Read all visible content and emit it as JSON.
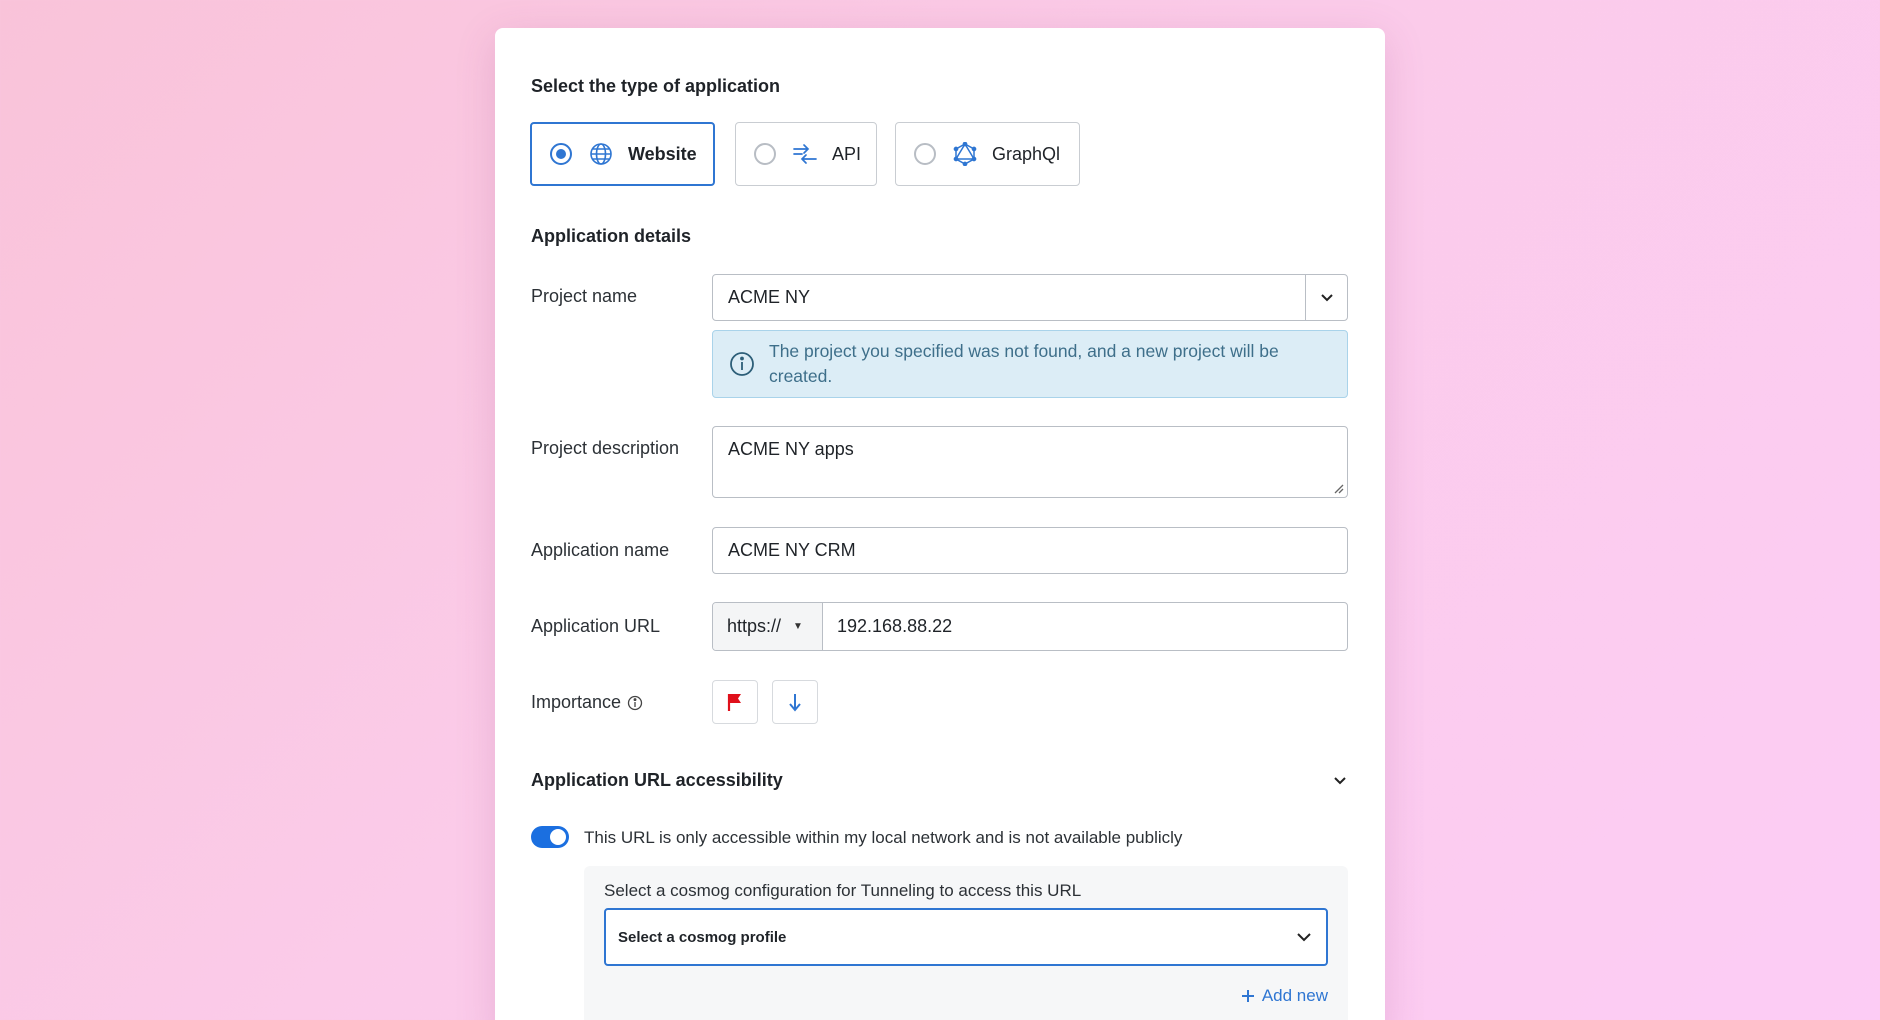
{
  "type_section": {
    "title": "Select the type of application",
    "options": [
      {
        "label": "Website",
        "selected": true,
        "icon": "globe-icon"
      },
      {
        "label": "API",
        "selected": false,
        "icon": "api-arrows-icon"
      },
      {
        "label": "GraphQl",
        "selected": false,
        "icon": "graphql-icon"
      }
    ]
  },
  "details": {
    "title": "Application details",
    "project_name": {
      "label": "Project name",
      "value": "ACME NY"
    },
    "info_message": "The project you specified was not found, and a new project will be created.",
    "project_description": {
      "label": "Project description",
      "value": "ACME NY apps"
    },
    "application_name": {
      "label": "Application name",
      "value": "ACME NY CRM"
    },
    "application_url": {
      "label": "Application URL",
      "protocol": "https://",
      "value": "192.168.88.22"
    },
    "importance": {
      "label": "Importance"
    }
  },
  "accessibility": {
    "title": "Application URL accessibility",
    "toggle_label": "This URL is only accessible within my local network and is not available publicly",
    "toggle_on": true,
    "tunnel_label": "Select a cosmog configuration for Tunneling to access this URL",
    "profile_placeholder": "Select a cosmog profile",
    "add_new": "Add new"
  },
  "colors": {
    "accent": "#2f76d2",
    "flag": "#e0101b",
    "info_bg": "#dcedf6"
  }
}
